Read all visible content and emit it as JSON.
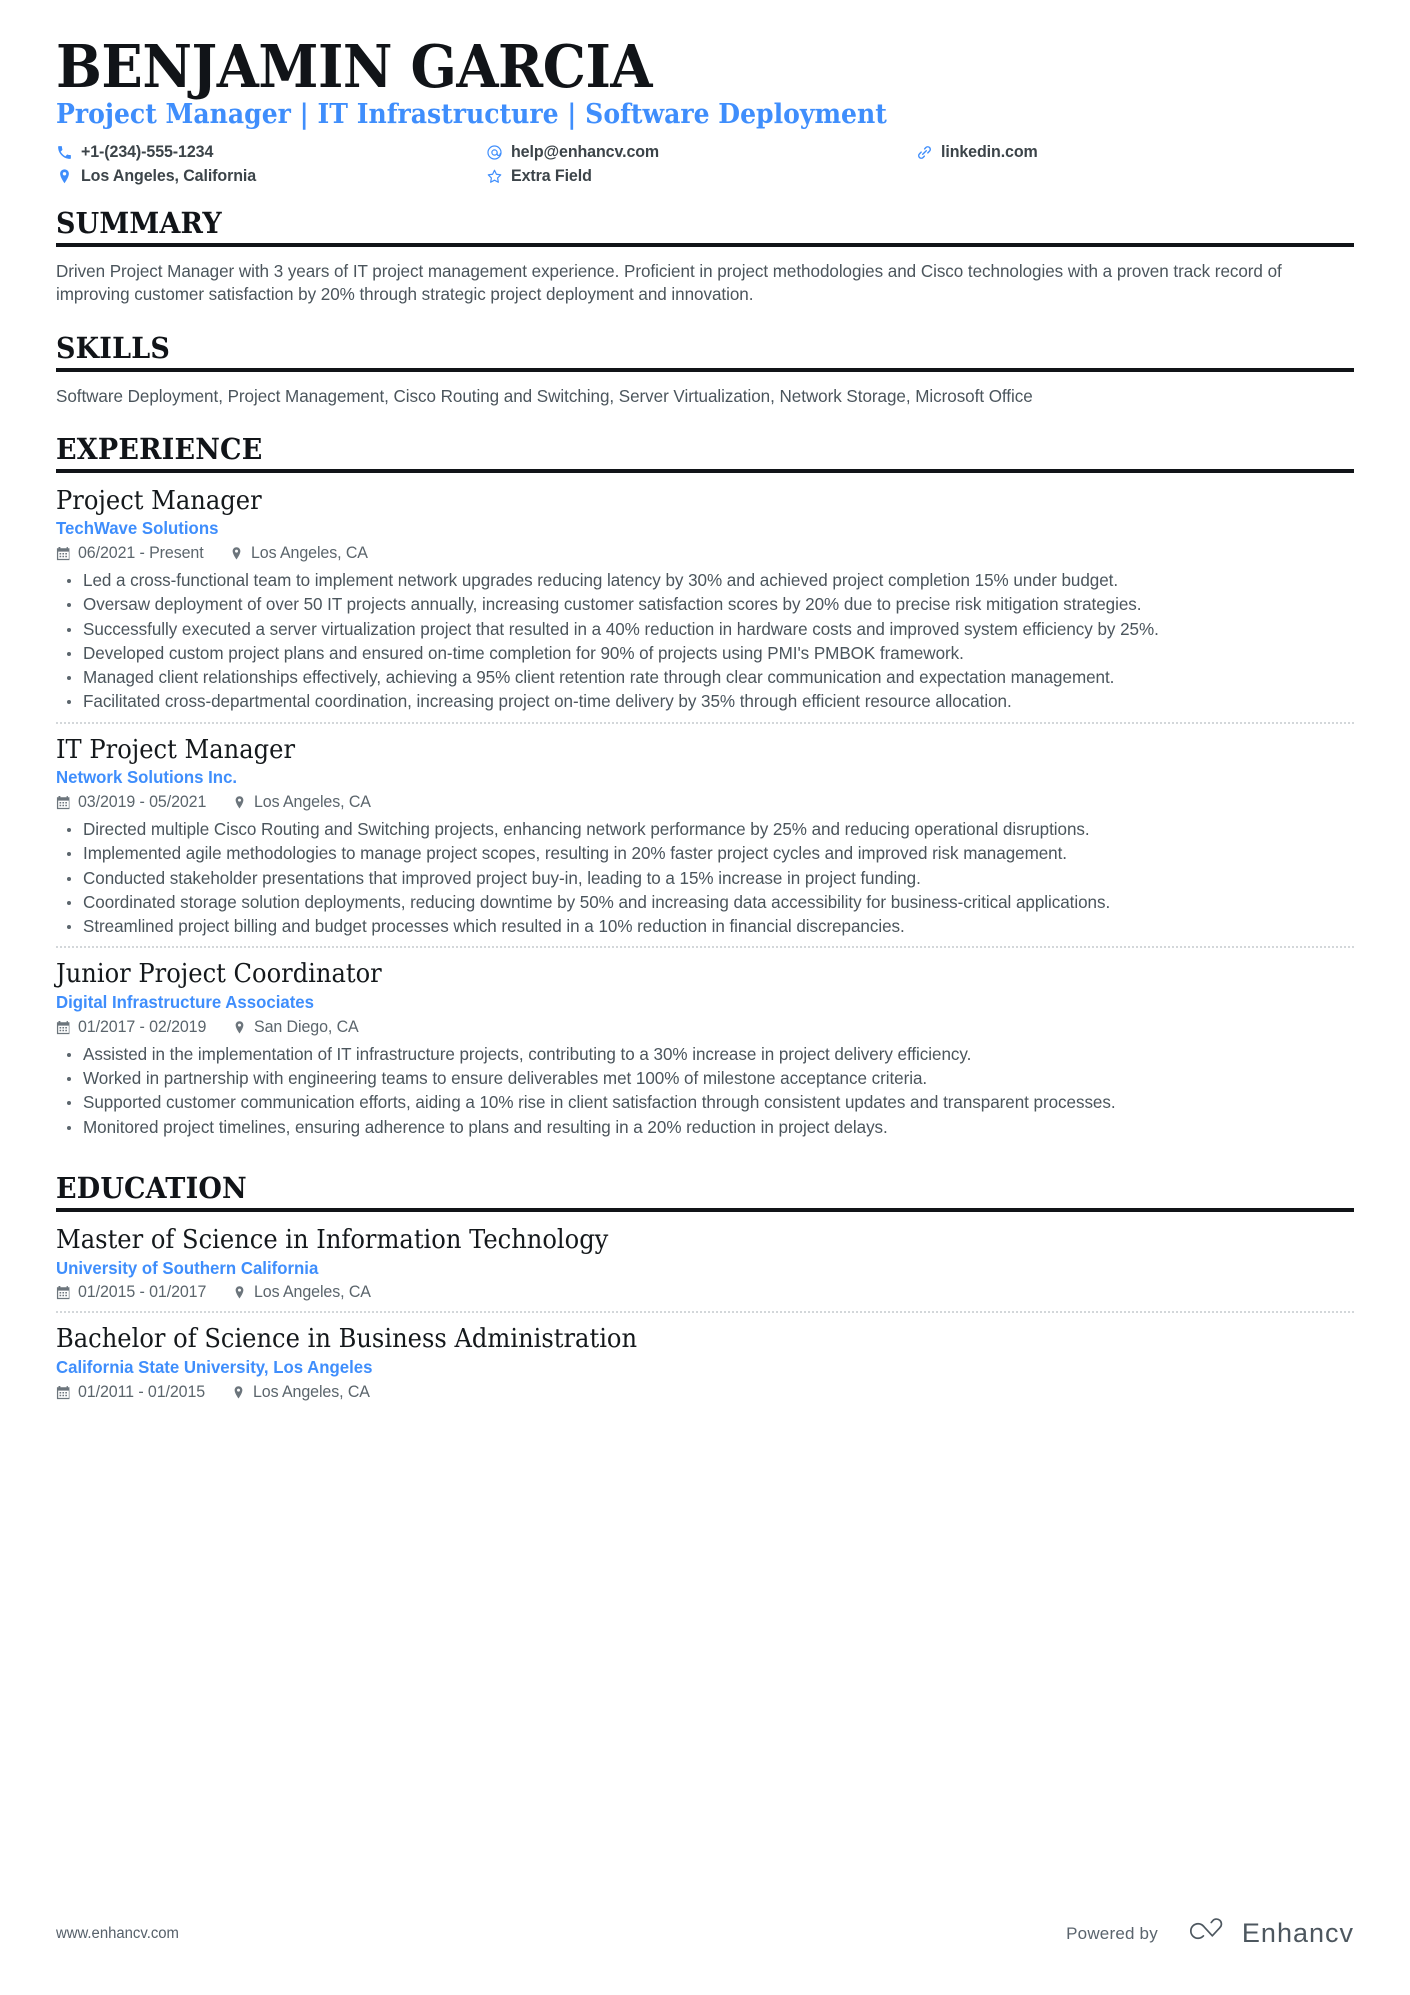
{
  "theme": {
    "accent": "#3f8efc",
    "text": "#4b555c",
    "heading": "#111418",
    "rule": "#111418",
    "separator": "#d3d7da"
  },
  "header": {
    "name": "BENJAMIN GARCIA",
    "headline": "Project Manager | IT Infrastructure | Software Deployment",
    "contacts": [
      {
        "icon": "phone-icon",
        "label": "+1-(234)-555-1234"
      },
      {
        "icon": "email-icon",
        "label": "help@enhancv.com"
      },
      {
        "icon": "link-icon",
        "label": "linkedin.com"
      },
      {
        "icon": "location-icon",
        "label": "Los Angeles, California"
      },
      {
        "icon": "star-icon",
        "label": "Extra Field"
      }
    ]
  },
  "sections": {
    "summary": {
      "title": "SUMMARY",
      "text": "Driven Project Manager with 3 years of IT project management experience. Proficient in project methodologies and Cisco technologies with a proven track record of improving customer satisfaction by 20% through strategic project deployment and innovation."
    },
    "skills": {
      "title": "SKILLS",
      "text": "Software Deployment, Project Management, Cisco Routing and Switching, Server Virtualization, Network Storage, Microsoft Office"
    },
    "experience": {
      "title": "EXPERIENCE",
      "entries": [
        {
          "title": "Project Manager",
          "org": "TechWave Solutions",
          "dates": "06/2021 - Present",
          "location": "Los Angeles, CA",
          "bullets": [
            "Led a cross-functional team to implement network upgrades reducing latency by 30% and achieved project completion 15% under budget.",
            "Oversaw deployment of over 50 IT projects annually, increasing customer satisfaction scores by 20% due to precise risk mitigation strategies.",
            "Successfully executed a server virtualization project that resulted in a 40% reduction in hardware costs and improved system efficiency by 25%.",
            "Developed custom project plans and ensured on-time completion for 90% of projects using PMI's PMBOK framework.",
            "Managed client relationships effectively, achieving a 95% client retention rate through clear communication and expectation management.",
            "Facilitated cross-departmental coordination, increasing project on-time delivery by 35% through efficient resource allocation."
          ]
        },
        {
          "title": "IT Project Manager",
          "org": "Network Solutions Inc.",
          "dates": "03/2019 - 05/2021",
          "location": "Los Angeles, CA",
          "bullets": [
            "Directed multiple Cisco Routing and Switching projects, enhancing network performance by 25% and reducing operational disruptions.",
            "Implemented agile methodologies to manage project scopes, resulting in 20% faster project cycles and improved risk management.",
            "Conducted stakeholder presentations that improved project buy-in, leading to a 15% increase in project funding.",
            "Coordinated storage solution deployments, reducing downtime by 50% and increasing data accessibility for business-critical applications.",
            "Streamlined project billing and budget processes which resulted in a 10% reduction in financial discrepancies."
          ]
        },
        {
          "title": "Junior Project Coordinator",
          "org": "Digital Infrastructure Associates",
          "dates": "01/2017 - 02/2019",
          "location": "San Diego, CA",
          "bullets": [
            "Assisted in the implementation of IT infrastructure projects, contributing to a 30% increase in project delivery efficiency.",
            "Worked in partnership with engineering teams to ensure deliverables met 100% of milestone acceptance criteria.",
            "Supported customer communication efforts, aiding a 10% rise in client satisfaction through consistent updates and transparent processes.",
            "Monitored project timelines, ensuring adherence to plans and resulting in a 20% reduction in project delays."
          ]
        }
      ]
    },
    "education": {
      "title": "EDUCATION",
      "entries": [
        {
          "title": "Master of Science in Information Technology",
          "org": "University of Southern California",
          "dates": "01/2015 - 01/2017",
          "location": "Los Angeles, CA"
        },
        {
          "title": "Bachelor of Science in Business Administration",
          "org": "California State University, Los Angeles",
          "dates": "01/2011 - 01/2015",
          "location": "Los Angeles, CA"
        }
      ]
    }
  },
  "footer": {
    "url": "www.enhancv.com",
    "powered_by": "Powered by",
    "brand": "Enhancv"
  }
}
